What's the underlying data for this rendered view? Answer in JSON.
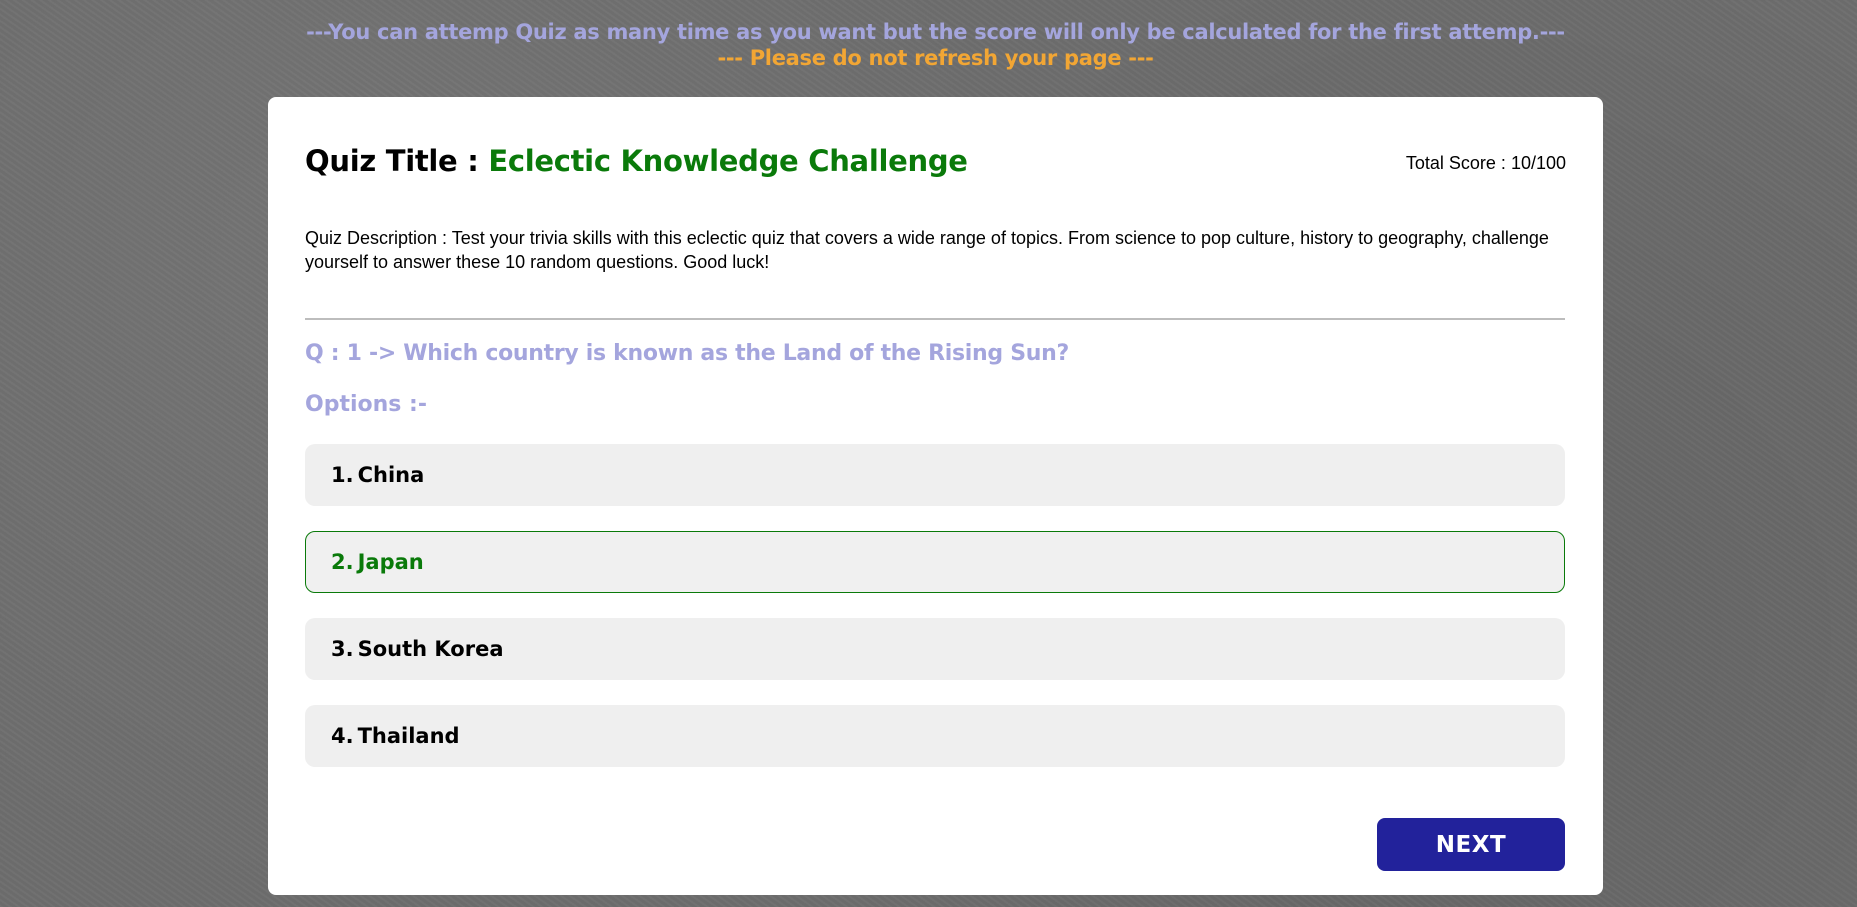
{
  "notices": {
    "attempt_notice": "---You can attemp Quiz as many time as you want but the score will only be calculated for the first attemp.---",
    "refresh_notice": "--- Please do not refresh your page ---"
  },
  "quiz": {
    "title_label": "Quiz Title : ",
    "title_value": "Eclectic Knowledge Challenge",
    "total_score_label": "Total Score : ",
    "total_score_value": "10/100",
    "description": "Quiz Description : Test your trivia skills with this eclectic quiz that covers a wide range of topics. From science to pop culture, history to geography, challenge yourself to answer these 10 random questions. Good luck!"
  },
  "question": {
    "text": "Q : 1 -> Which country is known as the Land of the Rising Sun?",
    "options_label": "Options :-",
    "options": [
      {
        "number": "1.",
        "label": "China",
        "selected": false
      },
      {
        "number": "2.",
        "label": "Japan",
        "selected": true
      },
      {
        "number": "3.",
        "label": "South Korea",
        "selected": false
      },
      {
        "number": "4.",
        "label": "Thailand",
        "selected": false
      }
    ]
  },
  "actions": {
    "next_label": "NEXT"
  },
  "colors": {
    "background": "#6e6e6e",
    "notice_lavender": "#a4a5dd",
    "notice_orange": "#f2a634",
    "title_green": "#0a7a0a",
    "option_bg": "#efefef",
    "button_navy": "#22229b"
  }
}
